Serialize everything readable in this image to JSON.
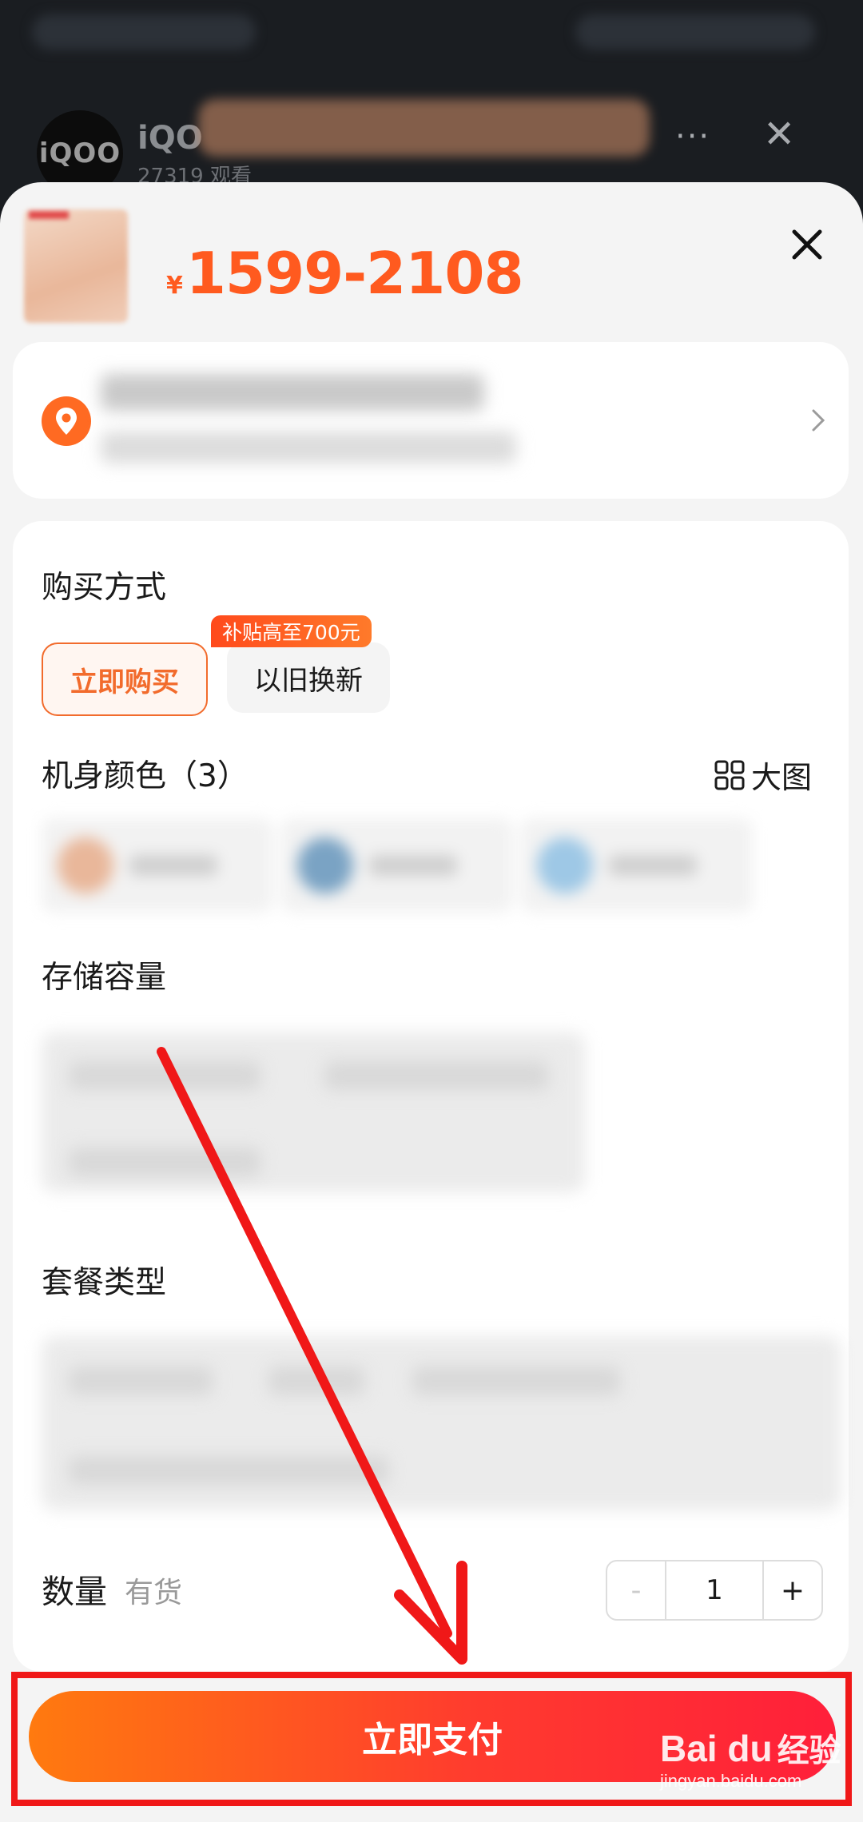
{
  "live": {
    "avatar_text": "iQOO",
    "name": "iQO",
    "viewers": "27319 观看",
    "more": "···",
    "close": "✕"
  },
  "product": {
    "currency": "¥",
    "price": "1599-2108"
  },
  "purchase": {
    "title": "购买方式",
    "buy_now": "立即购买",
    "trade_in": "以旧换新",
    "subsidy_badge": "补贴高至700元"
  },
  "color": {
    "title": "机身颜色（3）",
    "big_image": "大图",
    "swatch_colors": [
      "#e9b79a",
      "#7aa3c4",
      "#9ec8e6"
    ]
  },
  "storage": {
    "title": "存储容量"
  },
  "package": {
    "title": "套餐类型"
  },
  "quantity": {
    "label": "数量",
    "stock": "有货",
    "minus": "-",
    "value": "1",
    "plus": "+"
  },
  "pay": {
    "label": "立即支付"
  },
  "watermark": {
    "logo": "Bai du",
    "cn": "经验",
    "url": "jingyan.baidu.com"
  },
  "colors": {
    "accent": "#ff5a1f",
    "annotation_red": "#f01818"
  }
}
